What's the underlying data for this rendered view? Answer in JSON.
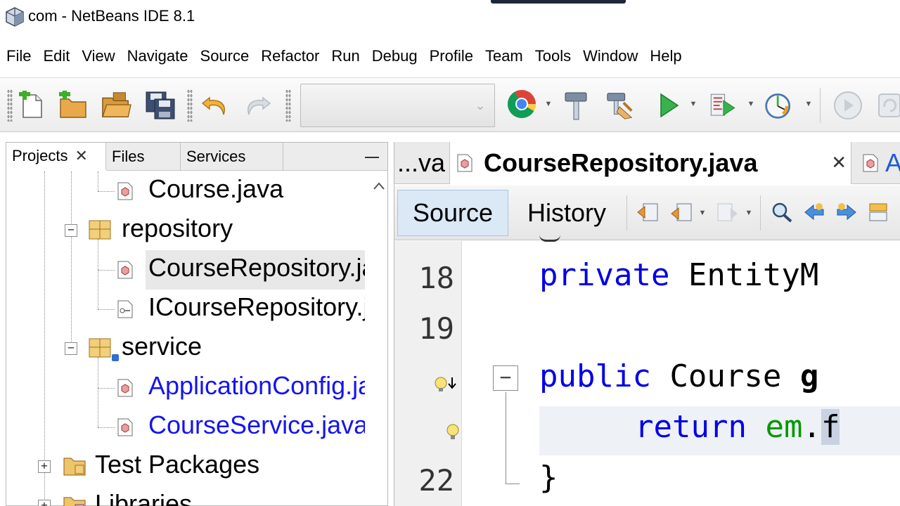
{
  "titlebar": {
    "title": "com - NetBeans IDE 8.1"
  },
  "menu": [
    "File",
    "Edit",
    "View",
    "Navigate",
    "Source",
    "Refactor",
    "Run",
    "Debug",
    "Profile",
    "Team",
    "Tools",
    "Window",
    "Help"
  ],
  "toolbar": {
    "buttons": [
      "new-file-icon",
      "new-project-icon",
      "open-project-icon",
      "save-all-icon",
      "undo-icon",
      "redo-icon",
      "chrome-icon",
      "build-icon",
      "clean-build-icon",
      "run-icon",
      "debug-project-icon",
      "profile-icon",
      "pause-icon",
      "refresh-icon"
    ],
    "config_value": ""
  },
  "projects": {
    "tabs": [
      {
        "label": "Projects",
        "close": "✕"
      },
      {
        "label": "Files"
      },
      {
        "label": "Services"
      }
    ],
    "tree": [
      {
        "label": "Course.java"
      },
      {
        "label": "repository",
        "toggle": "−"
      },
      {
        "label": "CourseRepository.java"
      },
      {
        "label": "ICourseRepository.java"
      },
      {
        "label": "service",
        "toggle": "−"
      },
      {
        "label": "ApplicationConfig.java"
      },
      {
        "label": "CourseService.java"
      },
      {
        "label": "Test Packages",
        "toggle": "+"
      },
      {
        "label": "Libraries",
        "toggle": "+"
      }
    ]
  },
  "editor": {
    "tabs": [
      {
        "label": "...va"
      },
      {
        "label": "CourseRepository.java",
        "close": "✕"
      },
      {
        "label": "A"
      }
    ],
    "source_label": "Source",
    "history_label": "History",
    "fold_marker": "−",
    "line_numbers": [
      "18",
      "19",
      "22"
    ],
    "code": {
      "line18_kw": "private",
      "line18_rest": " EntityM",
      "line20_kw": "public",
      "line20_rest": " Course ",
      "line20_tail": "g",
      "line21_kw": "return",
      "line21_var": "em",
      "line21_dot": ".",
      "line21_tail": "f",
      "line22": "}"
    }
  }
}
